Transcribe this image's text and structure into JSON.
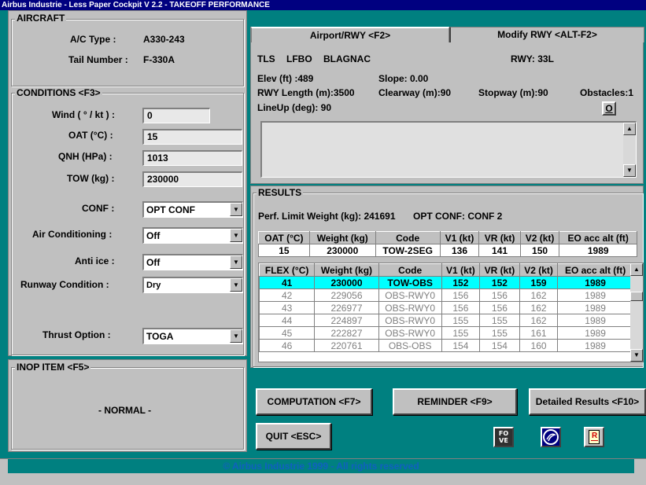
{
  "window_title": "Airbus Industrie - Less Paper Cockpit V 2.2 - TAKEOFF PERFORMANCE",
  "aircraft": {
    "title": "AIRCRAFT",
    "ac_type_label": "A/C Type :",
    "ac_type": "A330-243",
    "tail_label": "Tail Number :",
    "tail": "F-330A"
  },
  "conditions": {
    "title": "CONDITIONS <F3>",
    "wind_label": "Wind ( ° / kt ) :",
    "wind": "0",
    "oat_label": "OAT (°C) :",
    "oat": "15",
    "qnh_label": "QNH (HPa) :",
    "qnh": "1013",
    "tow_label": "TOW (kg) :",
    "tow": "230000",
    "conf_label": "CONF :",
    "conf": "OPT CONF",
    "aircond_label": "Air Conditioning :",
    "aircond": "Off",
    "antiice_label": "Anti ice :",
    "antiice": "Off",
    "rwycond_label": "Runway Condition :",
    "rwycond": "Dry",
    "thrust_label": "Thrust Option :",
    "thrust": "TOGA"
  },
  "inop": {
    "title": "INOP ITEM <F5>",
    "status": "- NORMAL -"
  },
  "airport": {
    "tab_active": "Airport/RWY <F2>",
    "tab_other": "Modify RWY <ALT-F2>",
    "code1": "TLS",
    "code2": "LFBO",
    "name": "BLAGNAC",
    "rwy": "RWY: 33L",
    "elev": "Elev (ft) :489",
    "slope": "Slope: 0.00",
    "rwy_length": "RWY Length (m):3500",
    "clearway": "Clearway (m):90",
    "stopway": "Stopway (m):90",
    "obstacles": "Obstacles:1",
    "lineup": "LineUp (deg): 90",
    "o_button": "O"
  },
  "results": {
    "title": "RESULTS",
    "perf_limit": "Perf. Limit Weight (kg): 241691",
    "opt_conf": "OPT CONF: CONF 2",
    "table1_headers": [
      "OAT (°C)",
      "Weight (kg)",
      "Code",
      "V1 (kt)",
      "VR (kt)",
      "V2 (kt)",
      "EO acc alt (ft)"
    ],
    "table1_row": [
      "15",
      "230000",
      "TOW-2SEG",
      "136",
      "141",
      "150",
      "1989"
    ],
    "table2_headers": [
      "FLEX (°C)",
      "Weight (kg)",
      "Code",
      "V1 (kt)",
      "VR (kt)",
      "V2 (kt)",
      "EO acc alt (ft)"
    ],
    "table2_rows": [
      [
        "41",
        "230000",
        "TOW-OBS",
        "152",
        "152",
        "159",
        "1989"
      ],
      [
        "42",
        "229056",
        "OBS-RWY0",
        "156",
        "156",
        "162",
        "1989"
      ],
      [
        "43",
        "226977",
        "OBS-RWY0",
        "156",
        "156",
        "162",
        "1989"
      ],
      [
        "44",
        "224897",
        "OBS-RWY0",
        "155",
        "155",
        "162",
        "1989"
      ],
      [
        "45",
        "222827",
        "OBS-RWY0",
        "155",
        "155",
        "161",
        "1989"
      ],
      [
        "46",
        "220761",
        "OBS-OBS",
        "154",
        "154",
        "160",
        "1989"
      ]
    ]
  },
  "buttons": {
    "computation": "COMPUTATION <F7>",
    "reminder": "REMINDER <F9>",
    "detailed": "Detailed Results <F10>",
    "quit": "QUIT <ESC>",
    "fo_ve": "FO VE",
    "report": "R"
  },
  "footer": "© Airbus Industrie 1999 - All rights reserved",
  "colors": {
    "background": "#008080",
    "titlebar": "#000080",
    "selected_row": "#00ffff",
    "footer_text": "#1060c0"
  }
}
